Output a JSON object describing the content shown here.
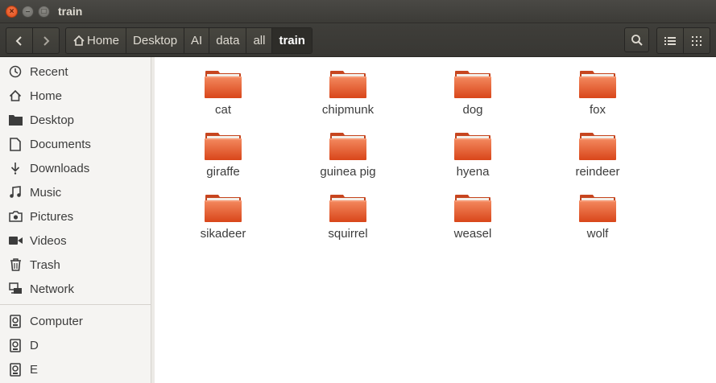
{
  "window": {
    "title": "train"
  },
  "window_controls": {
    "close": "×",
    "minimize": "–",
    "maximize": "□"
  },
  "nav": {
    "back": "back",
    "forward": "forward"
  },
  "breadcrumb": [
    "Home",
    "Desktop",
    "AI",
    "data",
    "all",
    "train"
  ],
  "sidebar": {
    "places": [
      {
        "label": "Recent",
        "icon": "clock-icon"
      },
      {
        "label": "Home",
        "icon": "home-icon"
      },
      {
        "label": "Desktop",
        "icon": "folder-icon"
      },
      {
        "label": "Documents",
        "icon": "document-icon"
      },
      {
        "label": "Downloads",
        "icon": "download-icon"
      },
      {
        "label": "Music",
        "icon": "music-icon"
      },
      {
        "label": "Pictures",
        "icon": "camera-icon"
      },
      {
        "label": "Videos",
        "icon": "video-icon"
      },
      {
        "label": "Trash",
        "icon": "trash-icon"
      },
      {
        "label": "Network",
        "icon": "network-icon"
      }
    ],
    "devices": [
      {
        "label": "Computer",
        "icon": "drive-icon"
      },
      {
        "label": "D",
        "icon": "drive-icon"
      },
      {
        "label": "E",
        "icon": "drive-icon"
      }
    ]
  },
  "files": [
    "cat",
    "chipmunk",
    "dog",
    "fox",
    "giraffe",
    "guinea pig",
    "hyena",
    "reindeer",
    "sikadeer",
    "squirrel",
    "weasel",
    "wolf"
  ],
  "colors": {
    "folder_top": "#f0795a",
    "folder_bottom": "#d84a1b",
    "titlebar": "#3c3b37",
    "close": "#df4a16"
  }
}
